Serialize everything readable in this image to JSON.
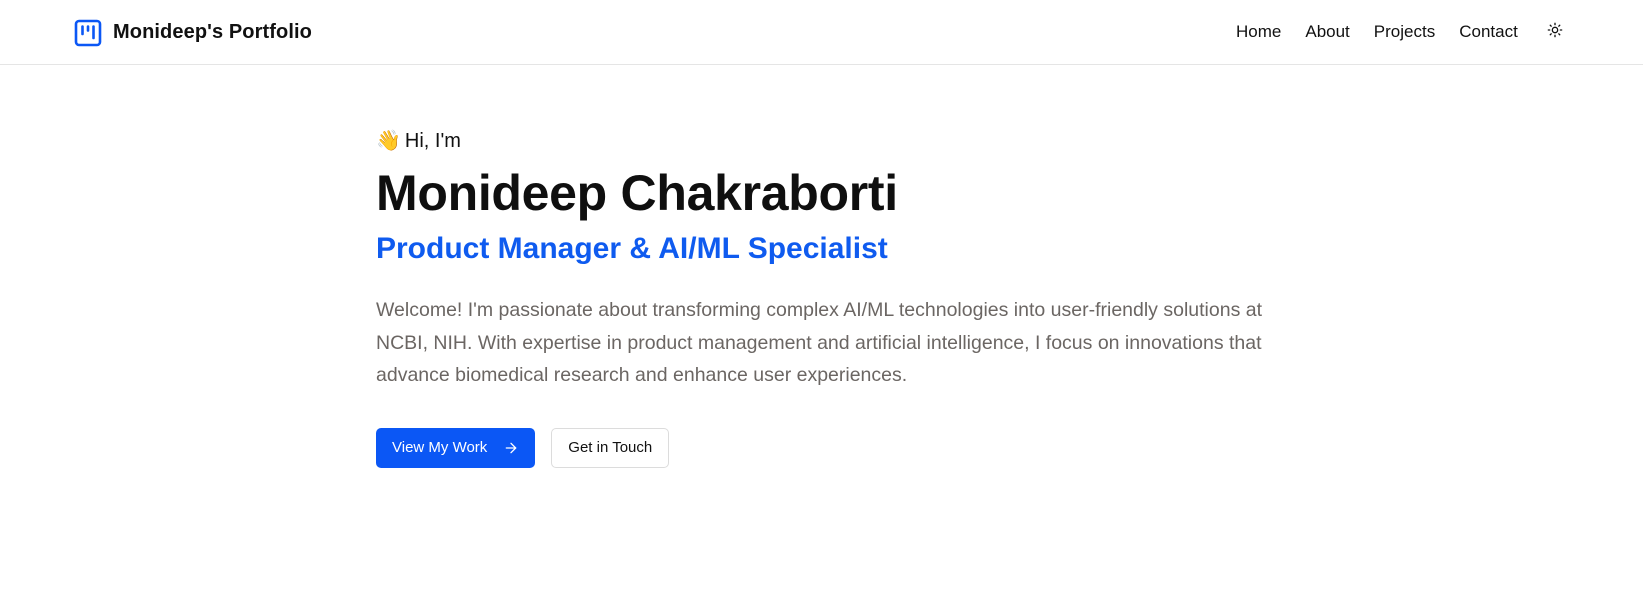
{
  "header": {
    "brand_name": "Monideep's Portfolio",
    "brand_icon": "kanban-square-icon",
    "nav": [
      {
        "label": "Home"
      },
      {
        "label": "About"
      },
      {
        "label": "Projects"
      },
      {
        "label": "Contact"
      }
    ],
    "theme_toggle_icon": "sun-icon"
  },
  "hero": {
    "wave_emoji": "👋",
    "greeting": "Hi, I'm",
    "name": "Monideep Chakraborti",
    "role": "Product Manager & AI/ML Specialist",
    "intro": "Welcome! I'm passionate about transforming complex AI/ML technologies into user-friendly solutions at NCBI, NIH. With expertise in product management and artificial intelligence, I focus on innovations that advance biomedical research and enhance user experiences.",
    "primary_button": "View My Work",
    "primary_button_icon": "arrow-right-icon",
    "secondary_button": "Get in Touch"
  },
  "colors": {
    "accent": "#0b57f5",
    "role_text": "#0f5bef",
    "body_text": "#6b6663",
    "border": "#e5e5e5"
  }
}
